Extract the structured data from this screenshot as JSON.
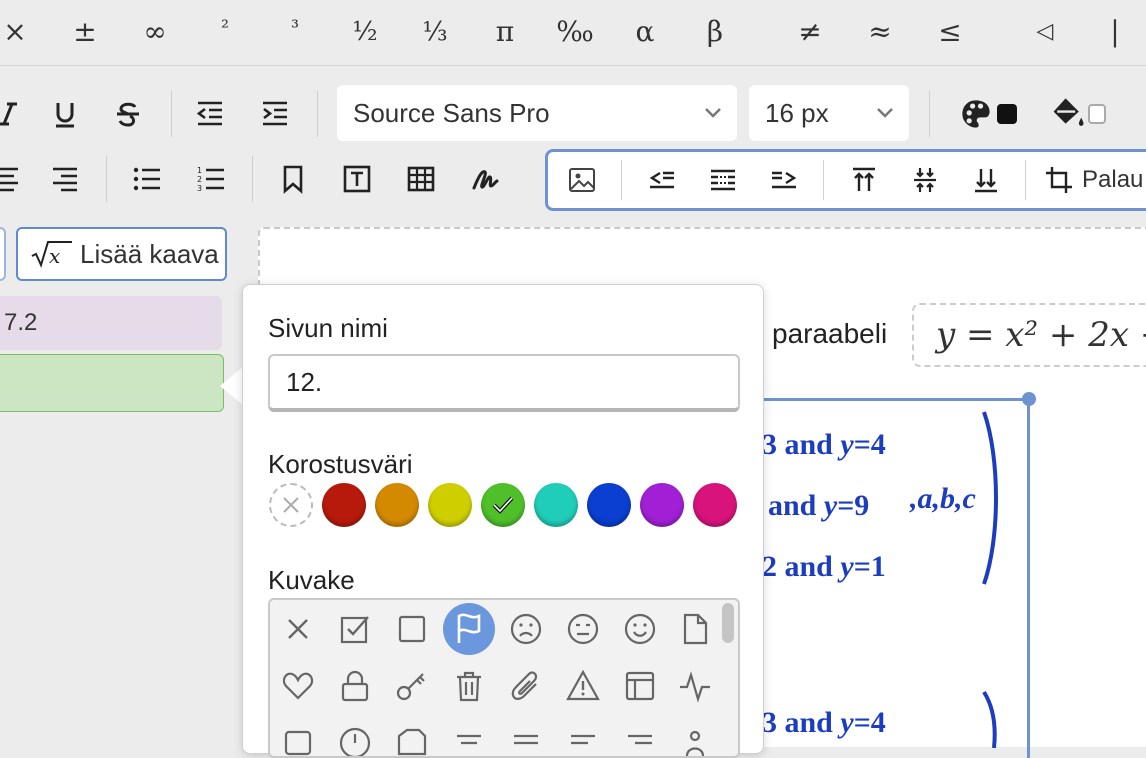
{
  "symbols": [
    "×",
    "±",
    "∞",
    "²",
    "³",
    "½",
    "⅓",
    "π",
    "‰",
    "α",
    "β",
    "≠",
    "≈",
    "≤",
    "◁",
    "|"
  ],
  "font": {
    "family": "Source Sans Pro",
    "size": "16 px"
  },
  "image_toolbar": {
    "reset_label": "Palau"
  },
  "left_panel": {
    "add_formula_label": "Lisää kaava",
    "pages": [
      {
        "label": "7.2"
      },
      {
        "label": ""
      }
    ]
  },
  "document": {
    "text": "paraabeli",
    "formula": "y = x² + 2x −",
    "lines": [
      {
        "prefix": "3 and ",
        "var": "y",
        "value": "=4"
      },
      {
        "prefix": " and ",
        "var": "y",
        "value": "=9"
      },
      {
        "prefix": "2 and ",
        "var": "y",
        "value": "=1"
      },
      {
        "prefix": "3 and ",
        "var": "y",
        "value": "=4"
      }
    ],
    "params": ",a,b,c"
  },
  "popover": {
    "page_name_label": "Sivun nimi",
    "page_name_value": "12.",
    "highlight_label": "Korostusväri",
    "colors": [
      "none",
      "#b71a0a",
      "#d48a00",
      "#cfcf00",
      "#4fc02a",
      "#20cdb8",
      "#0a3fd1",
      "#a120d6",
      "#d9137c"
    ],
    "selected_color_index": 4,
    "icon_label": "Kuvake",
    "icons": [
      "close-icon",
      "checkbox-checked-icon",
      "checkbox-empty-icon",
      "flag-icon",
      "sad-face-icon",
      "neutral-face-icon",
      "happy-face-icon",
      "document-icon",
      "heart-icon",
      "lock-icon",
      "key-icon",
      "trash-icon",
      "paperclip-icon",
      "warning-icon",
      "table-icon",
      "pulse-icon"
    ],
    "selected_icon_index": 3
  }
}
